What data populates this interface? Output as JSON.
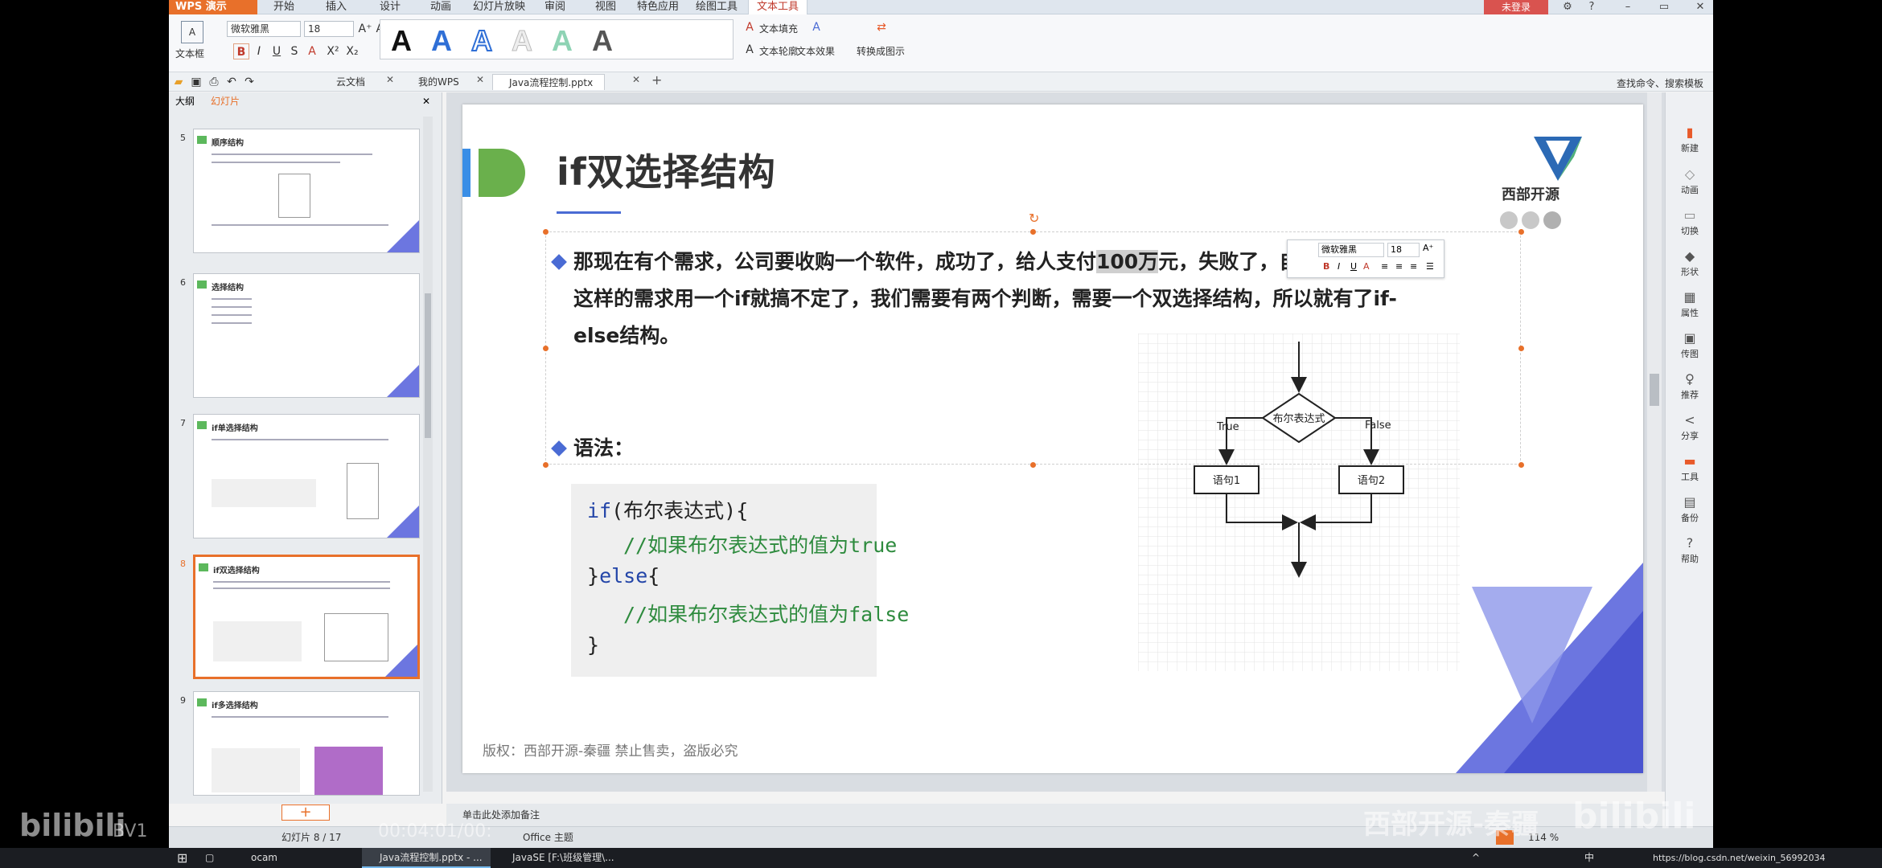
{
  "menubar": {
    "app_button": "WPS 演示",
    "items": [
      "开始",
      "插入",
      "设计",
      "动画",
      "幻灯片放映",
      "审阅",
      "视图",
      "特色应用",
      "绘图工具",
      "文本工具"
    ],
    "login": "未登录"
  },
  "ribbon": {
    "textbox_label": "文本框",
    "font_name": "微软雅黑",
    "font_size": "18",
    "text_fill": "文本填充",
    "text_outline": "文本轮廓",
    "text_effect": "文本效果",
    "convert": "转换成图示"
  },
  "tabs": {
    "items": [
      "云文档",
      "我的WPS",
      "Java流程控制.pptx"
    ],
    "search": "查找命令、搜索模板"
  },
  "left_panel": {
    "tab_outline": "大纲",
    "tab_slides": "幻灯片",
    "thumbnails": [
      {
        "num": "5",
        "title": "顺序结构"
      },
      {
        "num": "6",
        "title": "选择结构"
      },
      {
        "num": "7",
        "title": "if单选择结构"
      },
      {
        "num": "8",
        "title": "if双选择结构"
      },
      {
        "num": "9",
        "title": "if多选择结构"
      }
    ],
    "add": "+"
  },
  "slide": {
    "title": "if双选择结构",
    "logo_text": "西部开源",
    "para1_lines": [
      "那现在有个需求，公司要收购一个软件，成功了，给人支付",
      "100万",
      "元，失败了，自己找人开发。",
      "这样的需求用一个if就搞不定了，我们需要有两个判断，需要一个双选择结构，所以就有了if-",
      "else结构。"
    ],
    "syntax_label": "语法：",
    "code": {
      "l1_kw": "if",
      "l1_rest": "(布尔表达式){",
      "l2_cm": "//如果布尔表达式的值为true",
      "l3_a": "}",
      "l3_kw": "else",
      "l3_b": "{",
      "l4_cm": "//如果布尔表达式的值为false",
      "l5": "}"
    },
    "copyright": "版权：西部开源-秦疆    禁止售卖，盗版必究",
    "flowchart": {
      "decision": "布尔表达式",
      "true_label": "True",
      "false_label": "False",
      "stmt1": "语句1",
      "stmt2": "语句2"
    },
    "minibar_font": "微软雅黑",
    "minibar_size": "18"
  },
  "right_sidebar": [
    "新建",
    "动画",
    "切换",
    "形状",
    "属性",
    "传图",
    "推荐",
    "分享",
    "工具",
    "备份",
    "帮助"
  ],
  "notes": "单击此处添加备注",
  "status": {
    "slide_pos": "幻灯片 8 / 17",
    "theme": "Office 主题",
    "zoom": "114 %"
  },
  "taskbar": {
    "items": [
      "ocam",
      "Java流程控制.pptx - ...",
      "JavaSE [F:\\班级管理\\..."
    ],
    "url": "https://blog.csdn.net/weixin_56992034"
  },
  "overlay": {
    "video_id": "BV1",
    "video_time": "00:04:01/00:",
    "brand": "西部开源-秦疆"
  }
}
